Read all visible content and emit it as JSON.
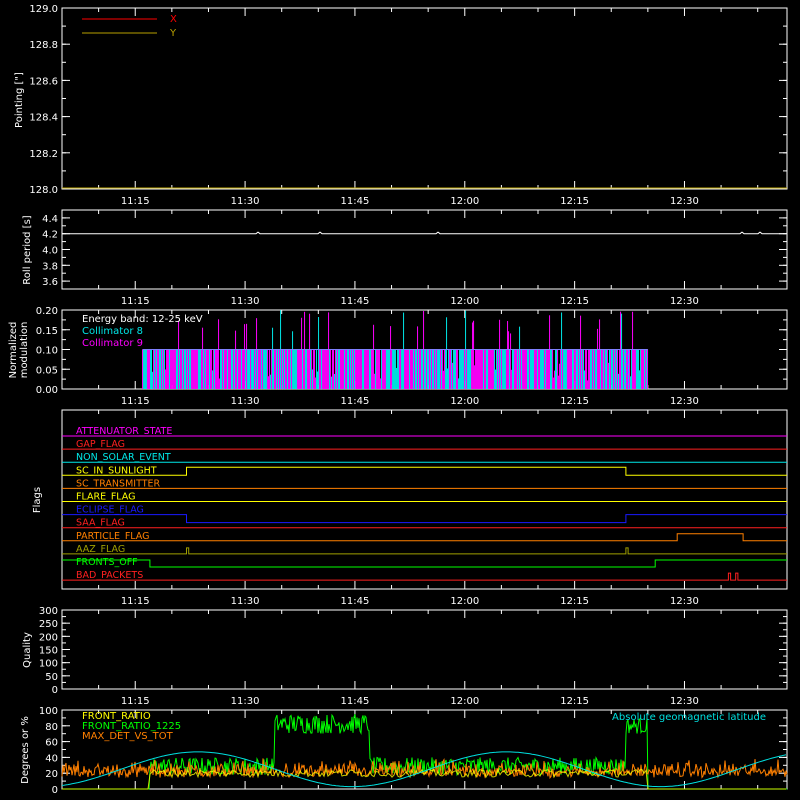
{
  "colors": {
    "background": "#000000",
    "axes": "#ffffff",
    "x_series": "#ff0000",
    "y_series": "#b8a000",
    "collimator_8": "#00e8e8",
    "collimator_9": "#ff00ff",
    "front_ratio": "#ffff00",
    "front_ratio_1225": "#00ff00",
    "max_det_vs_tot": "#ff8000",
    "geomag": "#00e0e0"
  },
  "chart_data": [
    {
      "id": "pointing",
      "type": "line",
      "ylabel": "Pointing [\"]",
      "ylim": [
        128.0,
        129.0
      ],
      "yticks": [
        "128.0",
        "128.2",
        "128.4",
        "128.6",
        "128.8",
        "129.0"
      ],
      "xticks": [
        "11:15",
        "11:30",
        "11:45",
        "12:00",
        "12:15",
        "12:30"
      ],
      "legend": "top-left",
      "series": [
        {
          "name": "X",
          "color": "#ff0000"
        },
        {
          "name": "Y",
          "color": "#b8a000",
          "value": 128.0
        }
      ]
    },
    {
      "id": "roll",
      "type": "line",
      "ylabel": "Roll period [s]",
      "ylim": [
        3.5,
        4.5
      ],
      "yticks": [
        "3.6",
        "3.8",
        "4.0",
        "4.2",
        "4.4"
      ],
      "xticks": [
        "11:15",
        "11:30",
        "11:45",
        "12:00",
        "12:15",
        "12:30"
      ],
      "series": [
        {
          "name": "",
          "value": 4.2
        }
      ]
    },
    {
      "id": "modulation",
      "type": "bar",
      "ylabel": "Normalized modulation",
      "ylim": [
        0.0,
        0.2
      ],
      "yticks": [
        "0.00",
        "0.05",
        "0.10",
        "0.15",
        "0.20"
      ],
      "xticks": [
        "11:15",
        "11:30",
        "11:45",
        "12:00",
        "12:15",
        "12:30"
      ],
      "annotation": "Energy band: 12-25 keV",
      "legend": "top-left",
      "series": [
        {
          "name": "Collimator 8",
          "color": "#00e8e8"
        },
        {
          "name": "Collimator 9",
          "color": "#ff00ff"
        }
      ],
      "x_range": [
        "11:16",
        "12:25"
      ],
      "base_level": 0.1,
      "peak_level": 0.2
    },
    {
      "id": "flags",
      "type": "line",
      "ylabel": "Flags",
      "xticks": [
        "11:15",
        "11:30",
        "11:45",
        "12:00",
        "12:15",
        "12:30"
      ],
      "flags": [
        {
          "name": "ATTENUATOR_STATE",
          "color": "#ff00ff"
        },
        {
          "name": "GAP_FLAG",
          "color": "#ff2020"
        },
        {
          "name": "NON_SOLAR_EVENT",
          "color": "#00e8e8"
        },
        {
          "name": "SC_IN_SUNLIGHT",
          "color": "#ffff00"
        },
        {
          "name": "SC_TRANSMITTER",
          "color": "#ff8000"
        },
        {
          "name": "FLARE_FLAG",
          "color": "#ffff00"
        },
        {
          "name": "ECLIPSE_FLAG",
          "color": "#1a1aff"
        },
        {
          "name": "SAA_FLAG",
          "color": "#ff2020"
        },
        {
          "name": "PARTICLE_FLAG",
          "color": "#ff8000"
        },
        {
          "name": "AAZ_FLAG",
          "color": "#a0a000"
        },
        {
          "name": "FRONTS_OFF",
          "color": "#00ff00"
        },
        {
          "name": "BAD_PACKETS",
          "color": "#ff2020"
        }
      ]
    },
    {
      "id": "quality",
      "type": "line",
      "ylabel": "Quality",
      "ylim": [
        0,
        300
      ],
      "yticks": [
        "0",
        "50",
        "100",
        "150",
        "200",
        "250",
        "300"
      ],
      "xticks": [
        "11:15",
        "11:30",
        "11:45",
        "12:00",
        "12:15",
        "12:30"
      ]
    },
    {
      "id": "ratios",
      "type": "line",
      "ylabel": "Degrees or %",
      "ylim": [
        0,
        100
      ],
      "yticks": [
        "0",
        "20",
        "40",
        "60",
        "80",
        "100"
      ],
      "legend": "top-left",
      "annotation": "Absolute geomagnetic latitude",
      "series": [
        {
          "name": "FRONT_RATIO",
          "color": "#ffff00"
        },
        {
          "name": "FRONT_RATIO_1225",
          "color": "#00ff00"
        },
        {
          "name": "MAX_DET_VS_TOT",
          "color": "#ff8000"
        }
      ]
    }
  ]
}
